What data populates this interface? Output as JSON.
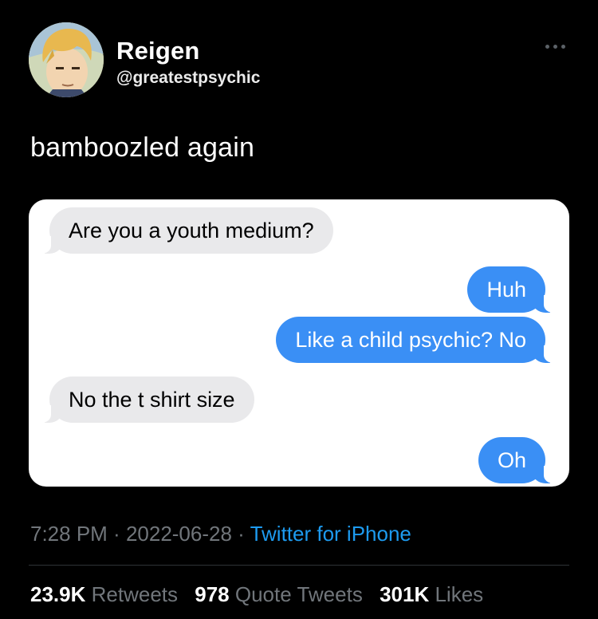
{
  "author": {
    "display_name": "Reigen",
    "handle": "@greatestpsychic"
  },
  "tweet": {
    "text": "bamboozled again"
  },
  "media": {
    "messages": [
      {
        "direction": "incoming",
        "text": "Are you a youth medium?"
      },
      {
        "direction": "outgoing",
        "text": "Huh"
      },
      {
        "direction": "outgoing",
        "text": "Like a child psychic? No"
      },
      {
        "direction": "incoming",
        "text": "No the t shirt size"
      },
      {
        "direction": "outgoing",
        "text": "Oh"
      }
    ]
  },
  "meta": {
    "time": "7:28 PM",
    "separator": " · ",
    "date": "2022-06-28",
    "source": "Twitter for iPhone"
  },
  "stats": {
    "retweets": {
      "count": "23.9K",
      "label": "Retweets"
    },
    "quotes": {
      "count": "978",
      "label": "Quote Tweets"
    },
    "likes": {
      "count": "301K",
      "label": "Likes"
    }
  },
  "colors": {
    "background": "#000000",
    "secondary_text": "#71767b",
    "link": "#1d9bf0",
    "imessage_blue": "#3a8ff5",
    "imessage_gray": "#e9e9eb"
  },
  "icons": {
    "more": "more-horizontal-icon"
  }
}
